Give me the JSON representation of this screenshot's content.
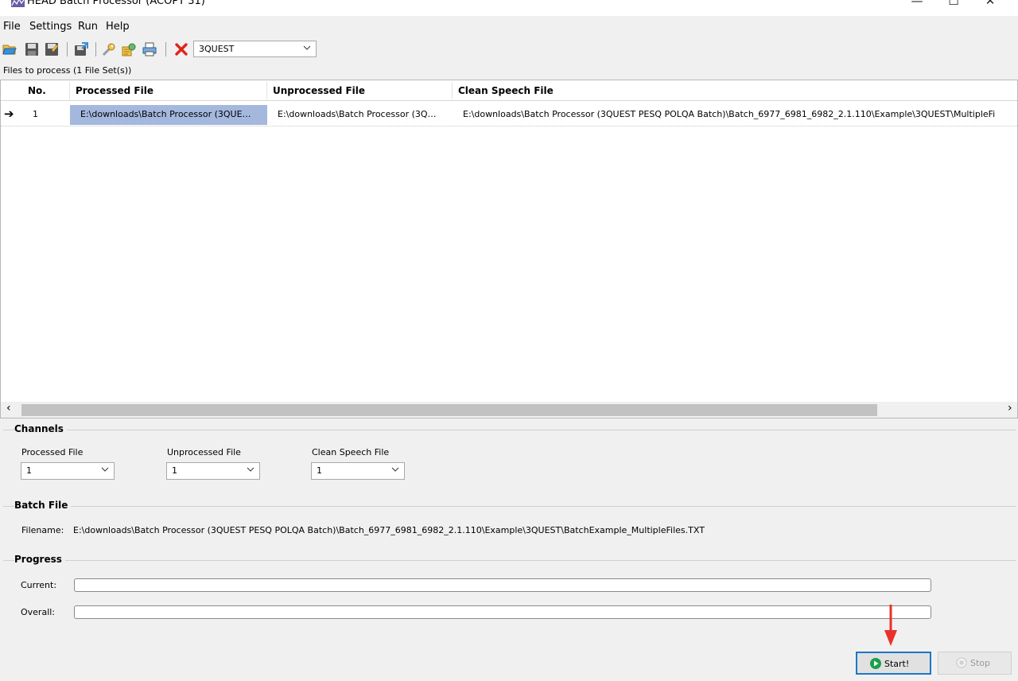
{
  "window": {
    "title": "HEAD Batch Processor (ACOPT 31)",
    "minimize_symbol": "—",
    "maximize_symbol": "☐",
    "close_symbol": "✕"
  },
  "menu": {
    "items": [
      "File",
      "Settings",
      "Run",
      "Help"
    ]
  },
  "toolbar": {
    "icons": [
      "open-folder-icon",
      "save-icon",
      "save-as-icon",
      "export-icon",
      "wrench-icon",
      "settings-wizard-icon",
      "print-icon",
      "delete-icon"
    ],
    "algorithm_select": {
      "value": "3QUEST"
    }
  },
  "files": {
    "label": "Files to process (1 File Set(s))",
    "columns": [
      "No.",
      "Processed File",
      "Unprocessed File",
      "Clean Speech File"
    ],
    "rows": [
      {
        "current_marker": "➔",
        "no": "1",
        "processed": "E:\\downloads\\Batch Processor (3QUE…",
        "unprocessed": "E:\\downloads\\Batch Processor (3Q…",
        "clean": "E:\\downloads\\Batch Processor (3QUEST  PESQ  POLQA Batch)\\Batch_6977_6981_6982_2.1.110\\Example\\3QUEST\\MultipleFi"
      }
    ],
    "scroll_left": "‹",
    "scroll_right": "›"
  },
  "channels": {
    "title": "Channels",
    "fields": [
      {
        "label": "Processed File",
        "value": "1"
      },
      {
        "label": "Unprocessed File",
        "value": "1"
      },
      {
        "label": "Clean Speech File",
        "value": "1"
      }
    ]
  },
  "batch_file": {
    "title": "Batch File",
    "filename_label": "Filename:",
    "filename": "E:\\downloads\\Batch Processor (3QUEST  PESQ  POLQA Batch)\\Batch_6977_6981_6982_2.1.110\\Example\\3QUEST\\BatchExample_MultipleFiles.TXT"
  },
  "progress": {
    "title": "Progress",
    "current_label": "Current:",
    "overall_label": "Overall:",
    "current_value": 0,
    "overall_value": 0
  },
  "buttons": {
    "start": "Start!",
    "stop": "Stop"
  },
  "colors": {
    "selection": "#a4b8de",
    "start_border": "#1a77c9",
    "start_icon": "#1aa049",
    "annotation_arrow": "#e8312a",
    "delete_icon": "#e0241b"
  }
}
